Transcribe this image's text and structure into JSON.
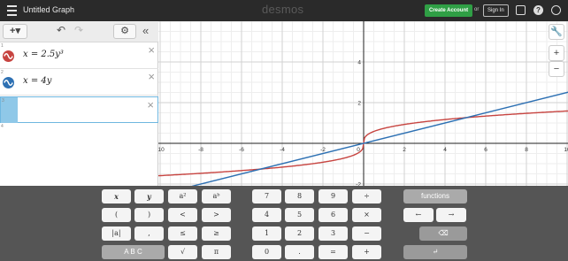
{
  "header": {
    "graph_title": "Untitled Graph",
    "brand": "desmos",
    "create_account_label": "Create Account",
    "or_text": "or",
    "sign_in_label": "Sign In",
    "menu_icon": "hamburger-menu-icon",
    "share_icon": "share-icon",
    "help_icon": "help-icon",
    "help_glyph": "?",
    "language_icon": "globe-icon"
  },
  "toolbar": {
    "add_label": "+▾",
    "undo_glyph": "↶",
    "redo_glyph": "↷",
    "settings_glyph": "⚙",
    "collapse_glyph": "«"
  },
  "expressions": [
    {
      "index": "1",
      "text": "x = 2.5y³",
      "color": "#c74440"
    },
    {
      "index": "2",
      "text": "x = 4y",
      "color": "#2d70b3"
    },
    {
      "index": "3",
      "text": "",
      "color": "#8fc8e8"
    },
    {
      "index": "4",
      "text": "",
      "color": ""
    }
  ],
  "graph": {
    "x_ticks": [
      "-10",
      "-8",
      "-6",
      "-4",
      "-2",
      "0",
      "2",
      "4",
      "6",
      "8",
      "10"
    ],
    "y_ticks": [
      "4",
      "2",
      "-2"
    ],
    "tools": {
      "wrench": "wrench-icon",
      "zoom_in": "+",
      "zoom_out": "−"
    }
  },
  "keypad": {
    "keys": [
      {
        "name": "key-x",
        "label": "x",
        "type": "light",
        "italic": true
      },
      {
        "name": "key-y",
        "label": "y",
        "type": "light",
        "italic": true
      },
      {
        "name": "key-a-squared",
        "label": "a²",
        "type": "light"
      },
      {
        "name": "key-a-power-b",
        "label": "aᵇ",
        "type": "light"
      },
      {
        "name": "key-7",
        "label": "7",
        "type": "light"
      },
      {
        "name": "key-8",
        "label": "8",
        "type": "light"
      },
      {
        "name": "key-9",
        "label": "9",
        "type": "light"
      },
      {
        "name": "key-divide",
        "label": "÷",
        "type": "light"
      },
      {
        "name": "key-functions",
        "label": "functions",
        "type": "dark"
      },
      {
        "name": "key-open-paren",
        "label": "(",
        "type": "light"
      },
      {
        "name": "key-close-paren",
        "label": ")",
        "type": "light"
      },
      {
        "name": "key-less-than",
        "label": "<",
        "type": "light"
      },
      {
        "name": "key-greater-than",
        "label": ">",
        "type": "light"
      },
      {
        "name": "key-4",
        "label": "4",
        "type": "light"
      },
      {
        "name": "key-5",
        "label": "5",
        "type": "light"
      },
      {
        "name": "key-6",
        "label": "6",
        "type": "light"
      },
      {
        "name": "key-multiply",
        "label": "×",
        "type": "light"
      },
      {
        "name": "key-left-arrow",
        "label": "←",
        "type": "light"
      },
      {
        "name": "key-right-arrow",
        "label": "→",
        "type": "light"
      },
      {
        "name": "key-abs",
        "label": "|a|",
        "type": "light"
      },
      {
        "name": "key-comma",
        "label": ",",
        "type": "light"
      },
      {
        "name": "key-less-equal",
        "label": "≤",
        "type": "light"
      },
      {
        "name": "key-greater-equal",
        "label": "≥",
        "type": "light"
      },
      {
        "name": "key-1",
        "label": "1",
        "type": "light"
      },
      {
        "name": "key-2",
        "label": "2",
        "type": "light"
      },
      {
        "name": "key-3",
        "label": "3",
        "type": "light"
      },
      {
        "name": "key-minus",
        "label": "−",
        "type": "light"
      },
      {
        "name": "key-backspace",
        "label": "⌫",
        "type": "light"
      },
      {
        "name": "key-abc",
        "label": "A B C",
        "type": "dark"
      },
      {
        "name": "key-sqrt",
        "label": "√",
        "type": "light"
      },
      {
        "name": "key-pi",
        "label": "π",
        "type": "light"
      },
      {
        "name": "key-0",
        "label": "0",
        "type": "light"
      },
      {
        "name": "key-decimal",
        "label": ".",
        "type": "light"
      },
      {
        "name": "key-equals",
        "label": "=",
        "type": "light"
      },
      {
        "name": "key-plus",
        "label": "+",
        "type": "light"
      },
      {
        "name": "key-enter",
        "label": "↵",
        "type": "light"
      }
    ]
  }
}
